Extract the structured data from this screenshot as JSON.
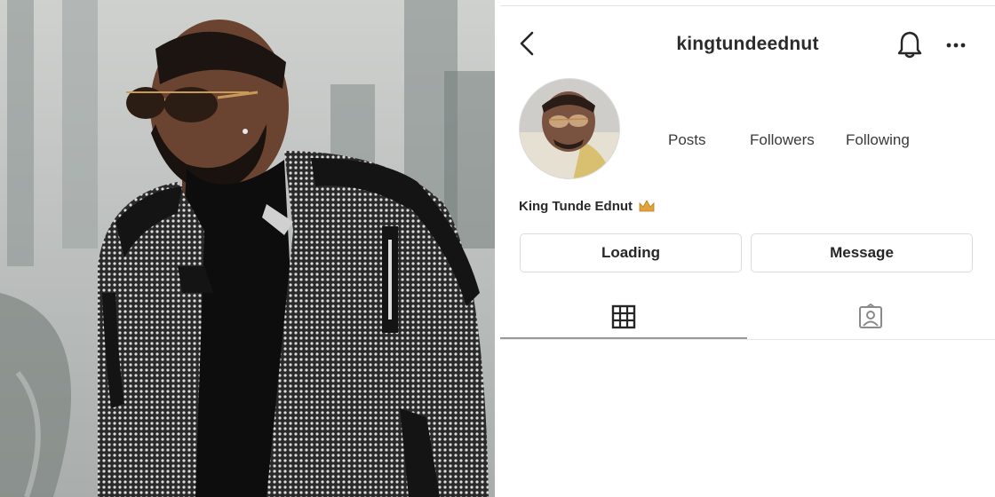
{
  "profile": {
    "username": "kingtundeednut",
    "display_name": "King Tunde Ednut",
    "stats": {
      "posts_label": "Posts",
      "followers_label": "Followers",
      "following_label": "Following"
    }
  },
  "actions": {
    "primary_label": "Loading",
    "message_label": "Message"
  },
  "icons": {
    "back": "chevron-left-icon",
    "notifications": "bell-icon",
    "more": "more-horizontal-icon",
    "name_emoji": "crown-icon",
    "grid_tab": "grid-icon",
    "tagged_tab": "tagged-person-icon"
  },
  "tabs": {
    "active": "grid"
  },
  "colors": {
    "text": "#262626",
    "border": "#dbdbdb",
    "jacket_pattern": "#d9d9d9",
    "jacket_trim": "#151515",
    "crown": "#e0a43a"
  }
}
